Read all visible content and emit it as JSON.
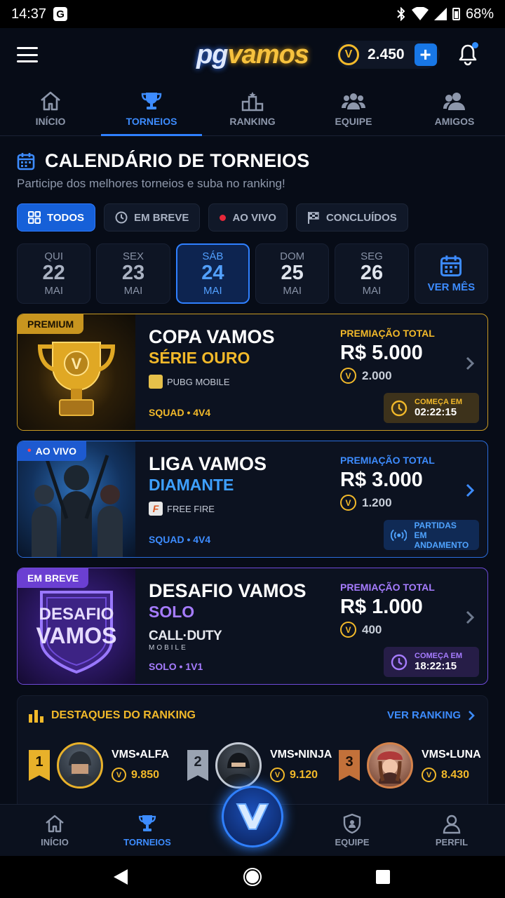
{
  "status_bar": {
    "time": "14:37",
    "battery": "68%"
  },
  "header": {
    "logo_pg": "pg",
    "logo_vamos": "vamos",
    "coin_balance": "2.450"
  },
  "top_tabs": [
    {
      "label": "INÍCIO",
      "icon": "home-icon"
    },
    {
      "label": "TORNEIOS",
      "icon": "trophy-icon"
    },
    {
      "label": "RANKING",
      "icon": "podium-icon"
    },
    {
      "label": "EQUIPE",
      "icon": "team-icon"
    },
    {
      "label": "AMIGOS",
      "icon": "friends-icon"
    }
  ],
  "section": {
    "title": "CALENDÁRIO DE TORNEIOS",
    "subtitle": "Participe dos melhores torneios e suba no ranking!"
  },
  "filters": [
    {
      "label": "TODOS",
      "icon": "grid-icon",
      "active": true
    },
    {
      "label": "EM BREVE",
      "icon": "clock-icon"
    },
    {
      "label": "AO VIVO",
      "icon": "live-dot-icon"
    },
    {
      "label": "CONCLUÍDOS",
      "icon": "checkered-flag-icon"
    }
  ],
  "dates": [
    {
      "weekday": "QUI",
      "day": "22",
      "month": "MAI"
    },
    {
      "weekday": "SEX",
      "day": "23",
      "month": "MAI"
    },
    {
      "weekday": "SÁB",
      "day": "24",
      "month": "MAI",
      "active": true
    },
    {
      "weekday": "DOM",
      "day": "25",
      "month": "MAI"
    },
    {
      "weekday": "SEG",
      "day": "26",
      "month": "MAI"
    }
  ],
  "view_month": "VER MÊS",
  "tournaments": [
    {
      "badge": "PREMIUM",
      "name": "COPA VAMOS",
      "series": "SÉRIE OURO",
      "game": "PUBG MOBILE",
      "mode": "SQUAD • 4V4",
      "prize_label": "PREMIAÇÃO TOTAL",
      "prize": "R$ 5.000",
      "coins": "2.000",
      "status_line1": "COMEÇA EM",
      "status_line2": "02:22:15"
    },
    {
      "badge": "AO VIVO",
      "name": "LIGA VAMOS",
      "series": "DIAMANTE",
      "game": "FREE FIRE",
      "mode": "SQUAD • 4V4",
      "prize_label": "PREMIAÇÃO TOTAL",
      "prize": "R$ 3.000",
      "coins": "1.200",
      "status_line1": "PARTIDAS",
      "status_line2": "EM ANDAMENTO"
    },
    {
      "badge": "EM BREVE",
      "name": "DESAFIO VAMOS",
      "series": "SOLO",
      "game": "CALL·DUTY",
      "game_sub": "MOBILE",
      "mode": "SOLO • 1V1",
      "art_line1": "DESAFIO",
      "art_line2": "VAMOS",
      "prize_label": "PREMIAÇÃO TOTAL",
      "prize": "R$ 1.000",
      "coins": "400",
      "status_line1": "COMEÇA EM",
      "status_line2": "18:22:15"
    }
  ],
  "ranking": {
    "title": "DESTAQUES DO RANKING",
    "link": "VER RANKING",
    "players": [
      {
        "pos": "1",
        "name": "VMS•ALFA",
        "points": "9.850"
      },
      {
        "pos": "2",
        "name": "VMS•NINJA",
        "points": "9.120"
      },
      {
        "pos": "3",
        "name": "VMS•LUNA",
        "points": "8.430"
      }
    ]
  },
  "bottom_nav": [
    {
      "label": "INÍCIO"
    },
    {
      "label": "TORNEIOS"
    },
    {
      "label": "EQUIPE"
    },
    {
      "label": "PERFIL"
    }
  ],
  "colors": {
    "accent": "#2f80ff",
    "gold": "#f2b92a",
    "purple": "#a67cff",
    "bg": "#070c17"
  }
}
